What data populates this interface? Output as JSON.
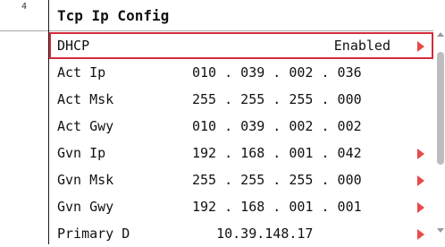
{
  "gutter": {
    "level": "4"
  },
  "header": {
    "title": "Tcp Ip Config"
  },
  "rows": [
    {
      "label": "DHCP",
      "value": "",
      "status": "Enabled",
      "arrow": true,
      "selected": true
    },
    {
      "label": "Act Ip",
      "value": "010 . 039 . 002 . 036",
      "status": "",
      "arrow": false,
      "selected": false
    },
    {
      "label": "Act Msk",
      "value": "255 . 255 . 255 . 000",
      "status": "",
      "arrow": false,
      "selected": false
    },
    {
      "label": "Act Gwy",
      "value": "010 . 039 . 002 . 002",
      "status": "",
      "arrow": false,
      "selected": false
    },
    {
      "label": "Gvn Ip",
      "value": "192 . 168 . 001 . 042",
      "status": "",
      "arrow": true,
      "selected": false
    },
    {
      "label": "Gvn Msk",
      "value": "255 . 255 . 255 . 000",
      "status": "",
      "arrow": true,
      "selected": false
    },
    {
      "label": "Gvn Gwy",
      "value": "192 . 168 . 001 . 001",
      "status": "",
      "arrow": true,
      "selected": false
    },
    {
      "label": "Primary D",
      "value": "   10.39.148.17",
      "status": "",
      "arrow": true,
      "selected": false
    }
  ],
  "colors": {
    "accent": "#d22c3b",
    "arrow": "#e84a4a"
  }
}
